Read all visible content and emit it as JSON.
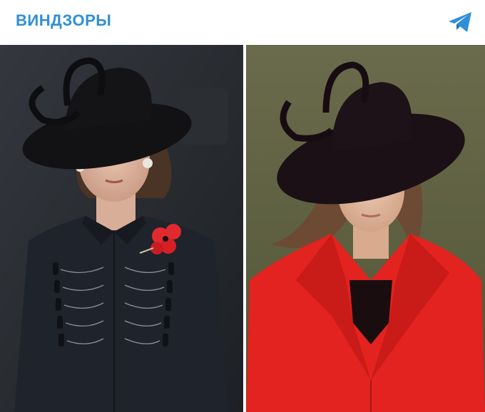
{
  "header": {
    "channel_title": "ВИНДЗОРЫ"
  },
  "icons": {
    "share": "telegram-plane-icon"
  },
  "photos": [
    {
      "name": "left-photo",
      "content": "woman-in-black-coat-and-black-hat"
    },
    {
      "name": "right-photo",
      "content": "woman-in-red-coat-and-black-hat"
    }
  ],
  "colors": {
    "accent": "#2f8fd8",
    "coat_left": "#1f232b",
    "coat_right": "#e3231f",
    "hat": "#1a1015",
    "poppy": "#e02a2f"
  }
}
